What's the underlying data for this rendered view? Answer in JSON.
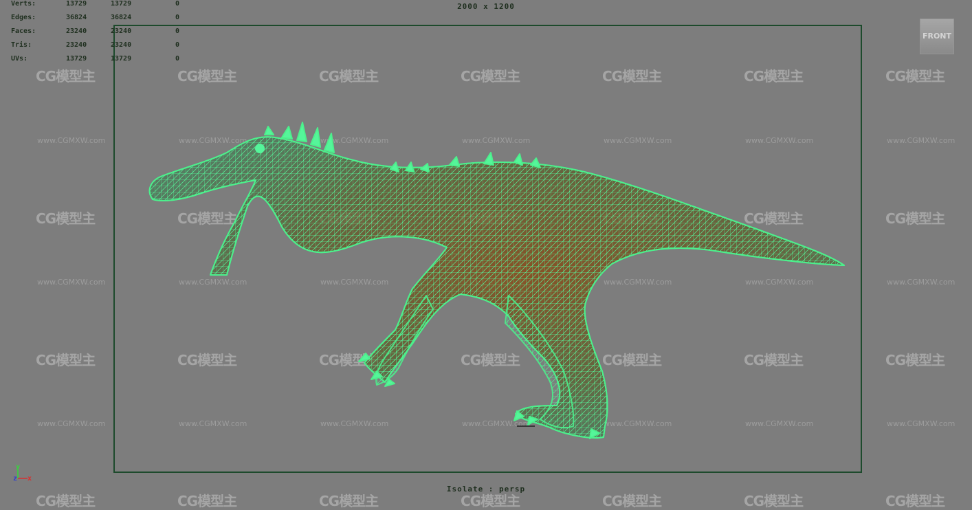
{
  "stats": [
    {
      "label": "Verts:",
      "v1": "13729",
      "v2": "13729",
      "v3": "0"
    },
    {
      "label": "Edges:",
      "v1": "36824",
      "v2": "36824",
      "v3": "0"
    },
    {
      "label": "Faces:",
      "v1": "23240",
      "v2": "23240",
      "v3": "0"
    },
    {
      "label": "Tris:",
      "v1": "23240",
      "v2": "23240",
      "v3": "0"
    },
    {
      "label": "UVs:",
      "v1": "13729",
      "v2": "13729",
      "v3": "0"
    }
  ],
  "resolution": "2000 x 1200",
  "camera": "Isolate : persp",
  "view_cube_label": "FRONT",
  "axis": {
    "y": "y",
    "z": "z",
    "x": "x",
    "y_color": "#34d83a",
    "z_color": "#2f3fd0",
    "x_color": "#d83030"
  },
  "watermark": {
    "logo": "CG模型主",
    "url": "www.CGMXW.com"
  },
  "colors": {
    "background": "#7d7d7d",
    "wireframe": "#55f59a",
    "gate": "#1d4a2c",
    "mesh_fill": "#5a5a2c"
  }
}
